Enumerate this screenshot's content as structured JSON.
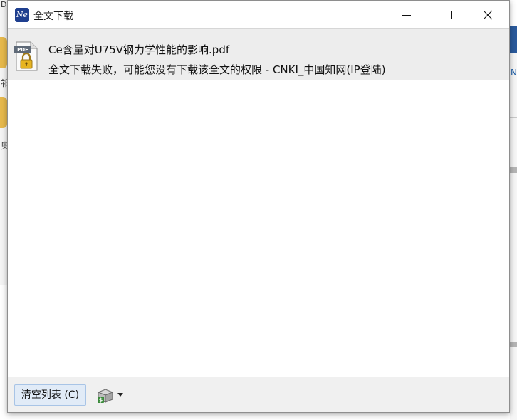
{
  "background": {
    "left_chars": [
      "D",
      "祁",
      "奥"
    ],
    "right_char": "N"
  },
  "window": {
    "title": "全文下载",
    "app_icon_text": "Ne",
    "controls": {
      "minimize": "minimize",
      "maximize": "maximize",
      "close": "close"
    }
  },
  "downloads": [
    {
      "file_name": "Ce含量对U75V钢力学性能的影响.pdf",
      "status": "全文下载失败，可能您没有下载该全文的权限  -  CNKI_中国知网(IP登陆)",
      "icon": "pdf-locked-icon"
    }
  ],
  "footer": {
    "clear_label": "清空列表 (C)",
    "tool_icon": "download-tool-icon",
    "dropdown_icon": "chevron-down-icon"
  },
  "colors": {
    "accent": "#1f3f8f",
    "selected_row": "#ededed",
    "button_bg": "#e1ebf7",
    "button_border": "#a8c4e6"
  }
}
